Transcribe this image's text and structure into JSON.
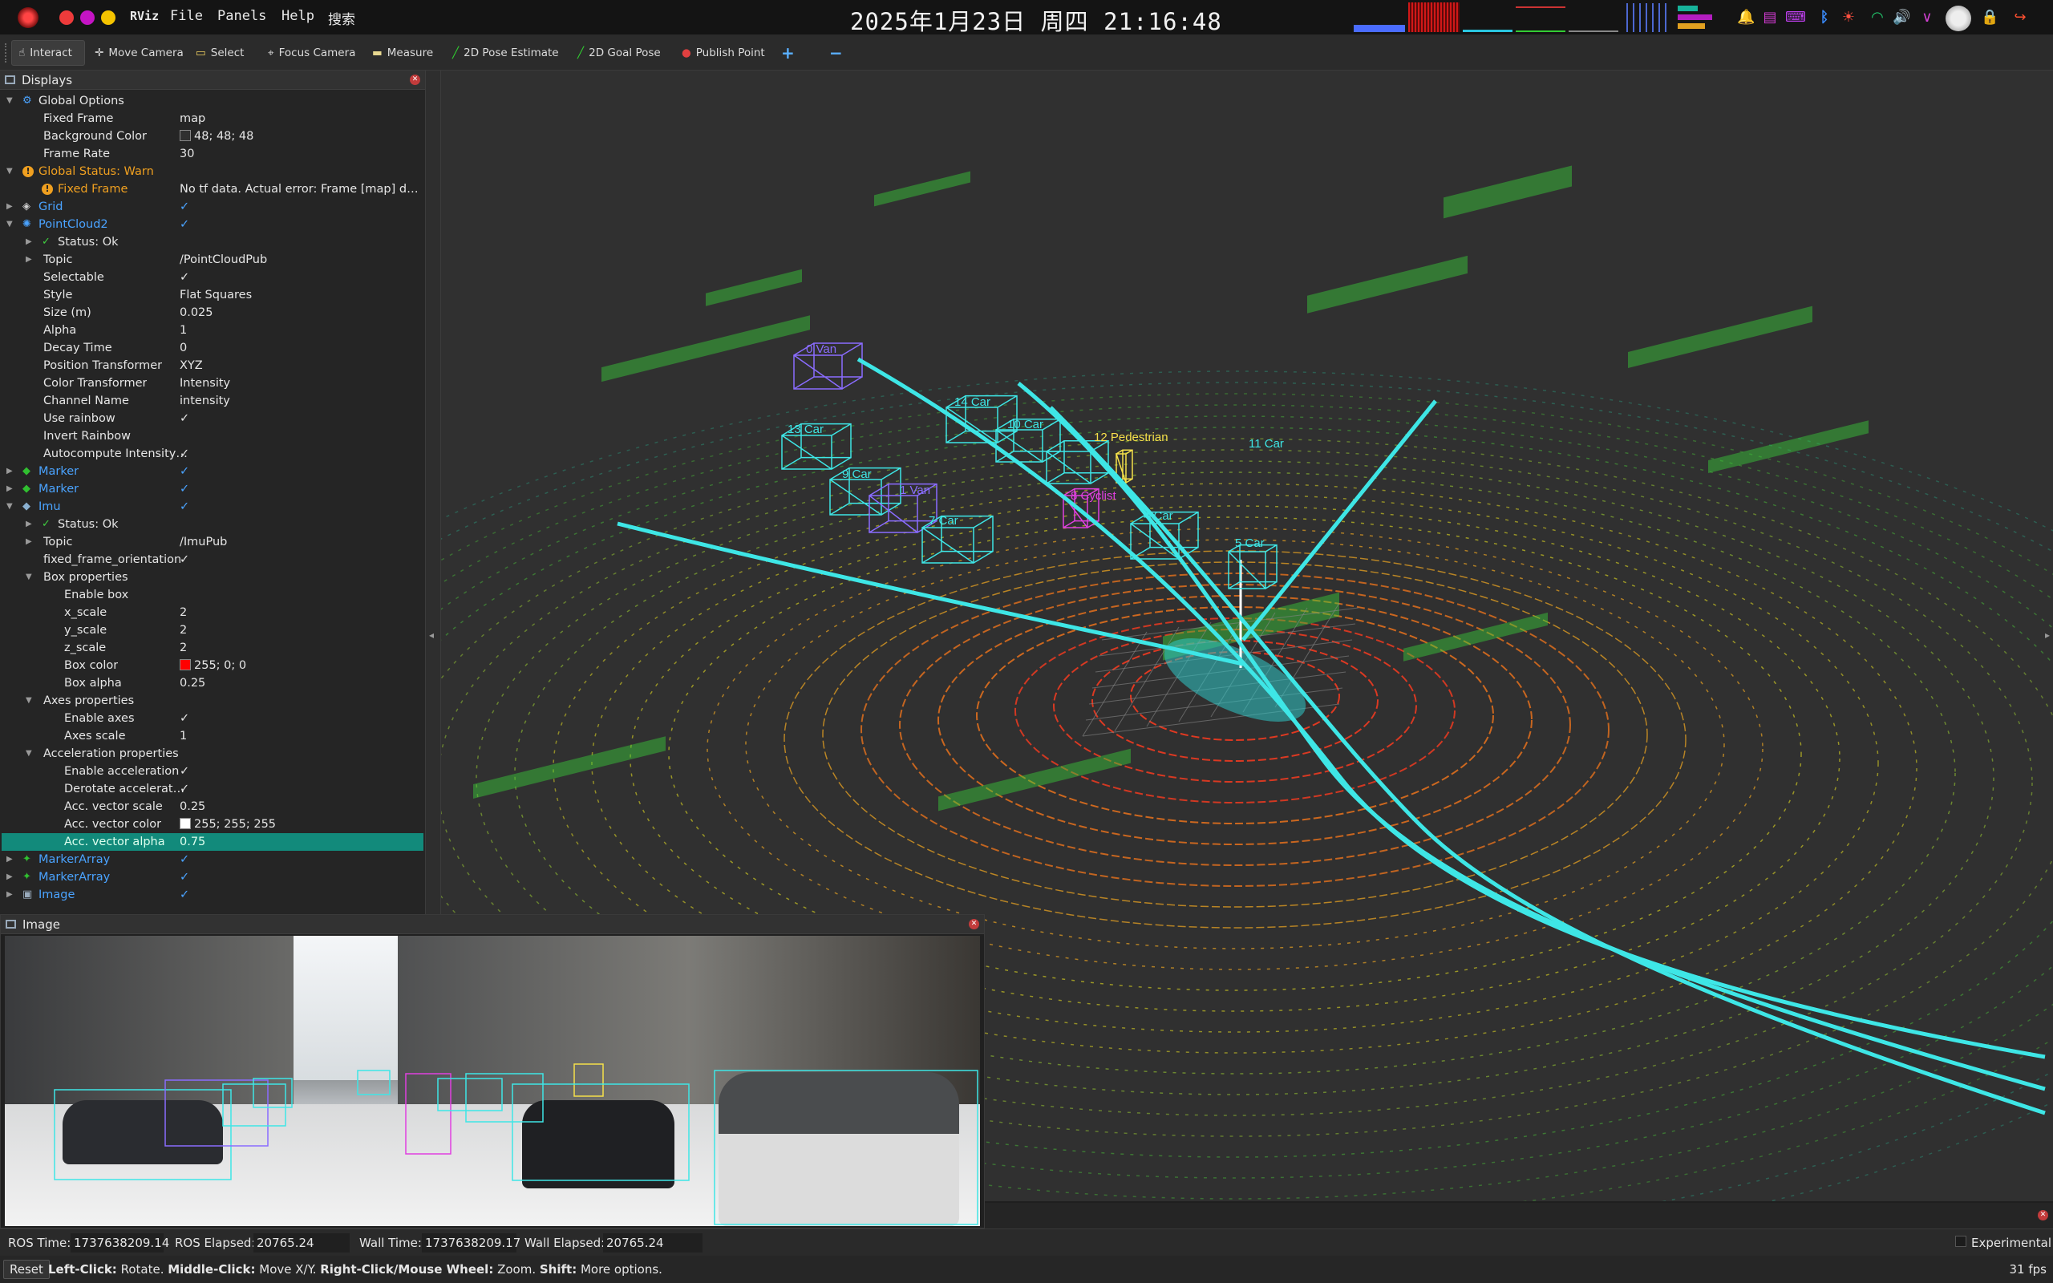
{
  "topbar": {
    "logo_text": "RViz",
    "menus": [
      "File",
      "Panels",
      "Help",
      "搜索"
    ],
    "clock": "2025年1月23日 周四 21:16:48",
    "tray_icons": [
      "bell-icon",
      "calendar-icon",
      "keyboard-icon",
      "bluetooth-icon",
      "brightness-icon",
      "wifi-icon",
      "volume-icon",
      "chevron-down-icon",
      "avatar",
      "lock-icon",
      "logout-icon"
    ]
  },
  "toolbar": {
    "tools": [
      "Interact",
      "Move Camera",
      "Select",
      "Focus Camera",
      "Measure",
      "2D Pose Estimate",
      "2D Goal Pose",
      "Publish Point"
    ],
    "add_label": "+",
    "remove_label": "−"
  },
  "displays": {
    "title": "Displays",
    "rows": [
      {
        "name": "Global Options",
        "value": "",
        "level": 0,
        "expanded": true,
        "icon": "gear-icon",
        "cls": ""
      },
      {
        "name": "Fixed Frame",
        "value": "map",
        "level": 1,
        "cls": ""
      },
      {
        "name": "Background Color",
        "value": "48; 48; 48",
        "swatch": "#303030",
        "level": 1,
        "cls": ""
      },
      {
        "name": "Frame Rate",
        "value": "30",
        "level": 1,
        "cls": ""
      },
      {
        "name": "Global Status: Warn",
        "value": "",
        "level": 0,
        "expanded": true,
        "icon": "warning-icon",
        "cls": "orange"
      },
      {
        "name": "Fixed Frame",
        "value": "No tf data.  Actual error: Frame [map] does …",
        "level": 1,
        "icon": "warning-icon",
        "cls": "orange",
        "indent": 2
      },
      {
        "name": "Grid",
        "value": "✓",
        "level": 0,
        "expanded": false,
        "icon": "grid-icon",
        "cls": "blue"
      },
      {
        "name": "PointCloud2",
        "value": "✓",
        "level": 0,
        "expanded": true,
        "icon": "pointcloud-icon",
        "cls": "blue"
      },
      {
        "name": "Status: Ok",
        "value": "",
        "level": 1,
        "expanded": false,
        "icon": "check-icon",
        "cls": "",
        "indent": 2
      },
      {
        "name": "Topic",
        "value": "/PointCloudPub",
        "level": 1,
        "expanded": false,
        "cls": "",
        "indent": 1
      },
      {
        "name": "Selectable",
        "value": "✓",
        "level": 1,
        "cls": ""
      },
      {
        "name": "Style",
        "value": "Flat Squares",
        "level": 1,
        "cls": ""
      },
      {
        "name": "Size (m)",
        "value": "0.025",
        "level": 1,
        "cls": ""
      },
      {
        "name": "Alpha",
        "value": "1",
        "level": 1,
        "cls": ""
      },
      {
        "name": "Decay Time",
        "value": "0",
        "level": 1,
        "cls": ""
      },
      {
        "name": "Position Transformer",
        "value": "XYZ",
        "level": 1,
        "cls": ""
      },
      {
        "name": "Color Transformer",
        "value": "Intensity",
        "level": 1,
        "cls": ""
      },
      {
        "name": "Channel Name",
        "value": "intensity",
        "level": 1,
        "cls": ""
      },
      {
        "name": "Use rainbow",
        "value": "✓",
        "level": 1,
        "cls": ""
      },
      {
        "name": "Invert Rainbow",
        "value": "",
        "level": 1,
        "cls": ""
      },
      {
        "name": "Autocompute Intensity…",
        "value": "✓",
        "level": 1,
        "cls": ""
      },
      {
        "name": "Marker",
        "value": "✓",
        "level": 0,
        "expanded": false,
        "icon": "marker-icon",
        "cls": "blue"
      },
      {
        "name": "Marker",
        "value": "✓",
        "level": 0,
        "expanded": false,
        "icon": "marker-icon",
        "cls": "blue"
      },
      {
        "name": "Imu",
        "value": "✓",
        "level": 0,
        "expanded": true,
        "icon": "imu-icon",
        "cls": "blue"
      },
      {
        "name": "Status: Ok",
        "value": "",
        "level": 1,
        "expanded": false,
        "icon": "check-icon",
        "cls": "",
        "indent": 2
      },
      {
        "name": "Topic",
        "value": "/ImuPub",
        "level": 1,
        "expanded": false,
        "cls": "",
        "indent": 1
      },
      {
        "name": "fixed_frame_orientation",
        "value": "✓",
        "level": 1,
        "cls": ""
      },
      {
        "name": "Box properties",
        "value": "",
        "level": 1,
        "expanded": true,
        "cls": "",
        "indent": 1
      },
      {
        "name": "Enable box",
        "value": "",
        "level": 2,
        "cls": ""
      },
      {
        "name": "x_scale",
        "value": "2",
        "level": 2,
        "cls": ""
      },
      {
        "name": "y_scale",
        "value": "2",
        "level": 2,
        "cls": ""
      },
      {
        "name": "z_scale",
        "value": "2",
        "level": 2,
        "cls": ""
      },
      {
        "name": "Box color",
        "value": "255; 0; 0",
        "swatch": "#ff0000",
        "level": 2,
        "cls": ""
      },
      {
        "name": "Box alpha",
        "value": "0.25",
        "level": 2,
        "cls": ""
      },
      {
        "name": "Axes properties",
        "value": "",
        "level": 1,
        "expanded": true,
        "cls": "",
        "indent": 1
      },
      {
        "name": "Enable axes",
        "value": "✓",
        "level": 2,
        "cls": ""
      },
      {
        "name": "Axes scale",
        "value": "1",
        "level": 2,
        "cls": ""
      },
      {
        "name": "Acceleration properties",
        "value": "",
        "level": 1,
        "expanded": true,
        "cls": "",
        "indent": 1
      },
      {
        "name": "Enable acceleration",
        "value": "✓",
        "level": 2,
        "cls": ""
      },
      {
        "name": "Derotate accelerat…",
        "value": "✓",
        "level": 2,
        "cls": ""
      },
      {
        "name": "Acc. vector scale",
        "value": "0.25",
        "level": 2,
        "cls": ""
      },
      {
        "name": "Acc. vector color",
        "value": "255; 255; 255",
        "swatch": "#ffffff",
        "level": 2,
        "cls": ""
      },
      {
        "name": "Acc. vector alpha",
        "value": "0.75",
        "level": 2,
        "cls": "sel"
      },
      {
        "name": "MarkerArray",
        "value": "✓",
        "level": 0,
        "expanded": false,
        "icon": "markerarray-icon",
        "cls": "blue"
      },
      {
        "name": "MarkerArray",
        "value": "✓",
        "level": 0,
        "expanded": false,
        "icon": "markerarray-icon",
        "cls": "blue"
      },
      {
        "name": "Image",
        "value": "✓",
        "level": 0,
        "expanded": false,
        "icon": "image-icon",
        "cls": "blue"
      }
    ]
  },
  "scene": {
    "labels": [
      {
        "text": "0 Van",
        "color": "#8a6cff"
      },
      {
        "text": "14 Car",
        "color": "#3ee6e6"
      },
      {
        "text": "13 Car",
        "color": "#3ee6e6"
      },
      {
        "text": "10 Car",
        "color": "#3ee6e6"
      },
      {
        "text": "12  Pedestrian",
        "color": "#f5e04a"
      },
      {
        "text": "11 Car",
        "color": "#3ee6e6"
      },
      {
        "text": "9 Car",
        "color": "#3ee6e6"
      },
      {
        "text": "1 Van",
        "color": "#8a6cff"
      },
      {
        "text": "8 Cyclist",
        "color": "#e040e0"
      },
      {
        "text": "7 Car",
        "color": "#3ee6e6"
      },
      {
        "text": "4 Car",
        "color": "#3ee6e6"
      },
      {
        "text": "5 Car",
        "color": "#3ee6e6"
      }
    ]
  },
  "image_panel": {
    "title": "Image"
  },
  "timebar": {
    "ros_time_label": "ROS Time:",
    "ros_time": "1737638209.14",
    "ros_elapsed_label": "ROS Elapsed:",
    "ros_elapsed": "20765.24",
    "wall_time_label": "Wall Time:",
    "wall_time": "1737638209.17",
    "wall_elapsed_label": "Wall Elapsed:",
    "wall_elapsed": "20765.24",
    "experimental": "Experimental"
  },
  "statusbar": {
    "reset": "Reset",
    "hint_parts": [
      {
        "b": "Left-Click:",
        "t": " Rotate. "
      },
      {
        "b": "Middle-Click:",
        "t": " Move X/Y. "
      },
      {
        "b": "Right-Click/Mouse Wheel:",
        "t": " Zoom. "
      },
      {
        "b": "Shift:",
        "t": " More options."
      }
    ],
    "fps": "31 fps"
  },
  "colors": {
    "accent": "#128a7b",
    "link": "#4aa3ff",
    "warn": "#f0a020",
    "cyan": "#3ee6e6"
  }
}
